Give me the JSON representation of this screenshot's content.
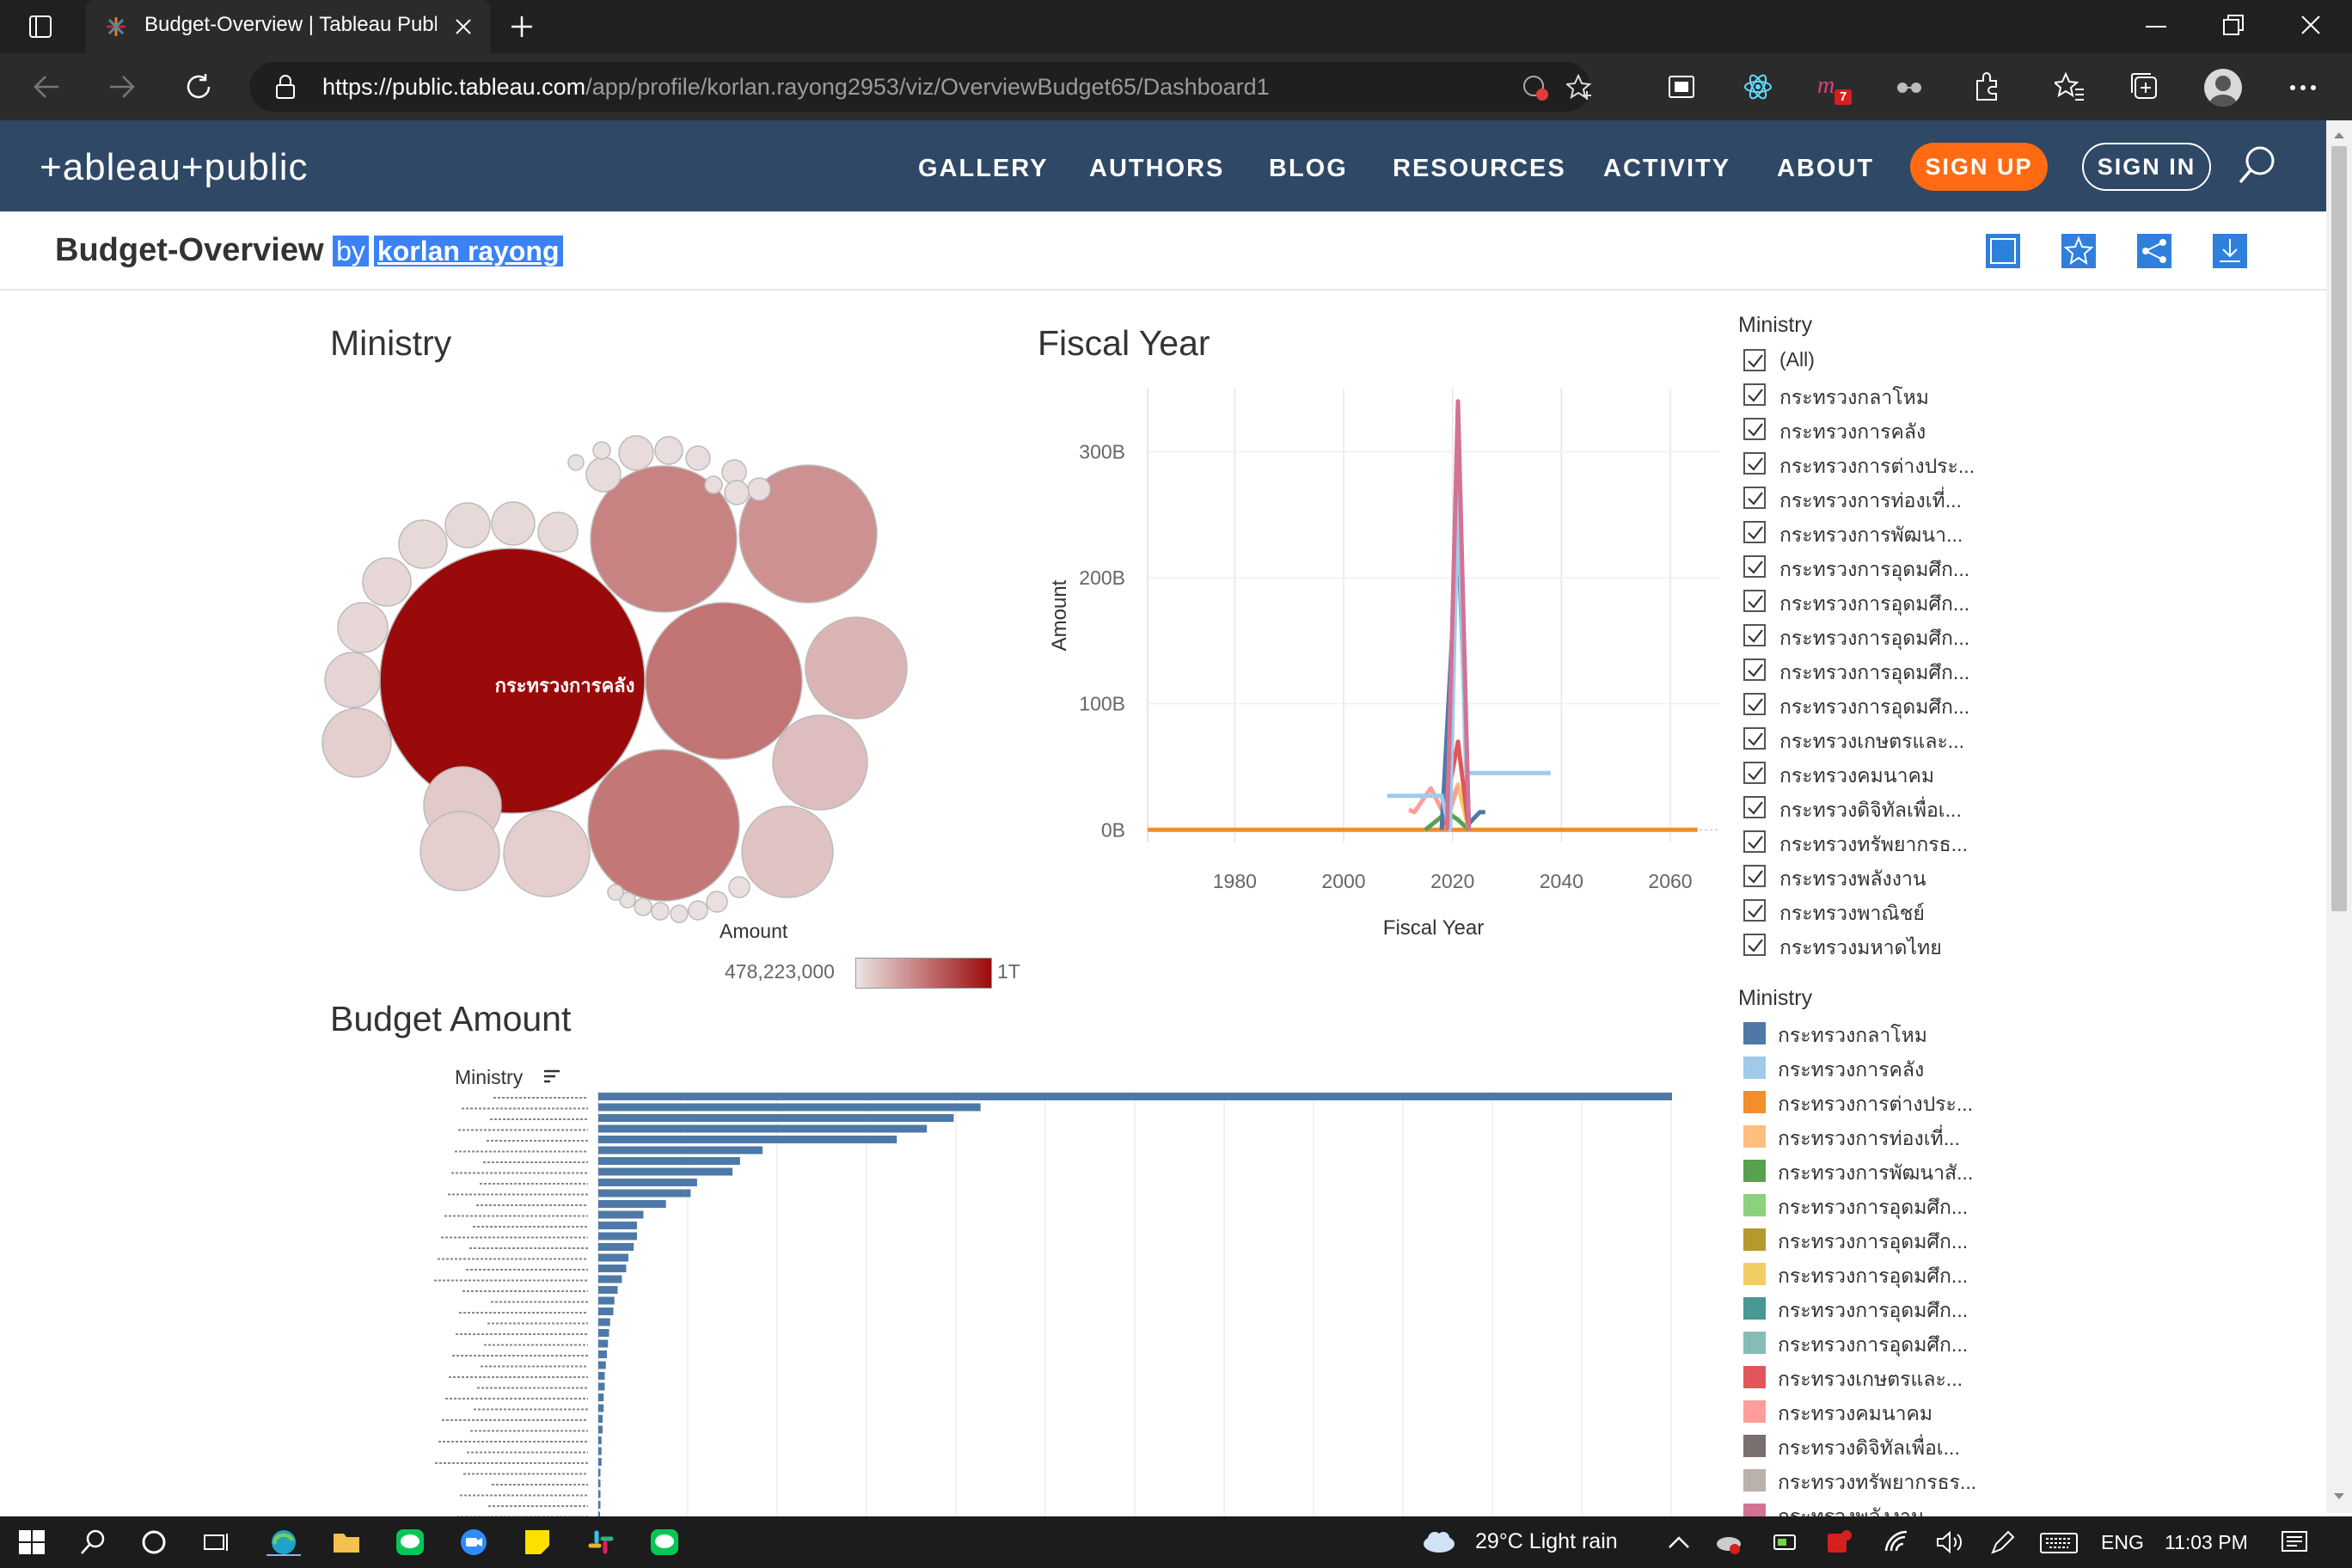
{
  "browser": {
    "tab_title": "Budget-Overview | Tableau Public",
    "url_host": "https://public.tableau.com",
    "url_path": "/app/profile/korlan.rayong2953/viz/OverviewBudget65/Dashboard1",
    "extension_badge": "7"
  },
  "site": {
    "logo": "+ableau+public",
    "nav": [
      "GALLERY",
      "AUTHORS",
      "BLOG",
      "RESOURCES",
      "ACTIVITY",
      "ABOUT"
    ],
    "sign_up": "SIGN UP",
    "sign_in": "SIGN IN"
  },
  "viz": {
    "title": "Budget-Overview",
    "by": "by",
    "author": "korlan rayong"
  },
  "bubble_sheet": {
    "title": "Ministry",
    "largest_label": "กระทรวงการคลัง",
    "legend_title": "Amount",
    "legend_min": "478,223,000",
    "legend_max": "1T",
    "color_low": "#ece4e4",
    "color_high": "#9b0a0a"
  },
  "line_sheet": {
    "title": "Fiscal Year"
  },
  "bar_sheet": {
    "title": "Budget Amount",
    "header": "Ministry",
    "bar_color": "#4e79a7"
  },
  "filter": {
    "title": "Ministry",
    "items": [
      "(All)",
      "กระทรวงกลาโหม",
      "กระทรวงการคลัง",
      "กระทรวงการต่างประ...",
      "กระทรวงการท่องเที่...",
      "กระทรวงการพัฒนา...",
      "กระทรวงการอุดมศึก...",
      "กระทรวงการอุดมศึก...",
      "กระทรวงการอุดมศึก...",
      "กระทรวงการอุดมศึก...",
      "กระทรวงการอุดมศึก...",
      "กระทรวงเกษตรและ...",
      "กระทรวงคมนาคม",
      "กระทรวงดิจิทัลเพื่อเ...",
      "กระทรวงทรัพยากรธ...",
      "กระทรวงพลังงาน",
      "กระทรวงพาณิชย์",
      "กระทรวงมหาดไทย"
    ]
  },
  "color_legend": {
    "title": "Ministry",
    "items": [
      {
        "label": "กระทรวงกลาโหม",
        "color": "#4e79a7"
      },
      {
        "label": "กระทรวงการคลัง",
        "color": "#a0cbe8"
      },
      {
        "label": "กระทรวงการต่างประ...",
        "color": "#f28e2b"
      },
      {
        "label": "กระทรวงการท่องเที่...",
        "color": "#ffbe7d"
      },
      {
        "label": "กระทรวงการพัฒนาสั...",
        "color": "#59a14f"
      },
      {
        "label": "กระทรวงการอุดมศึก...",
        "color": "#8cd17d"
      },
      {
        "label": "กระทรวงการอุดมศึก...",
        "color": "#b6992d"
      },
      {
        "label": "กระทรวงการอุดมศึก...",
        "color": "#f1ce63"
      },
      {
        "label": "กระทรวงการอุดมศึก...",
        "color": "#499894"
      },
      {
        "label": "กระทรวงการอุดมศึก...",
        "color": "#86bcb6"
      },
      {
        "label": "กระทรวงเกษตรและ...",
        "color": "#e15759"
      },
      {
        "label": "กระทรวงคมนาคม",
        "color": "#ff9d9a"
      },
      {
        "label": "กระทรวงดิจิทัลเพื่อเ...",
        "color": "#79706e"
      },
      {
        "label": "กระทรวงทรัพยากรธร...",
        "color": "#bab0ac"
      },
      {
        "label": "กระทรวงพลังงาน",
        "color": "#d37295"
      }
    ]
  },
  "taskbar": {
    "weather": "29°C  Light rain",
    "lang": "ENG",
    "time": "11:03 PM"
  },
  "chart_data": [
    {
      "type": "line",
      "title": "Fiscal Year",
      "xlabel": "Fiscal Year",
      "ylabel": "Amount",
      "x_ticks": [
        "1980",
        "2000",
        "2020",
        "2040",
        "2060"
      ],
      "y_ticks": [
        "0B",
        "100B",
        "200B",
        "300B"
      ],
      "xlim": [
        1964,
        2069
      ],
      "ylim": [
        -10,
        350
      ],
      "grid": true,
      "series": [
        {
          "name": "กระทรวงพลังงาน",
          "color": "#d37295",
          "points": [
            [
              2019,
              0
            ],
            [
              2021,
              340
            ],
            [
              2023,
              0
            ]
          ]
        },
        {
          "name": "กระทรวงการคลัง",
          "color": "#a0cbe8",
          "points": [
            [
              2008,
              27
            ],
            [
              2018,
              27
            ],
            [
              2019.5,
              0
            ],
            [
              2021,
              270
            ],
            [
              2022.5,
              45
            ],
            [
              2038,
              45
            ]
          ]
        },
        {
          "name": "กระทรวงกลาโหม",
          "color": "#4e79a7",
          "points": [
            [
              2018,
              0
            ],
            [
              2021,
              240
            ],
            [
              2023,
              5
            ],
            [
              2025,
              14
            ],
            [
              2026,
              14
            ]
          ]
        },
        {
          "name": "กระทรวงคมนาคม",
          "color": "#ff9d9a",
          "points": [
            [
              2012,
              16
            ],
            [
              2013,
              14
            ],
            [
              2016,
              33
            ],
            [
              2018,
              16
            ],
            [
              2019,
              8
            ],
            [
              2021,
              35
            ]
          ]
        },
        {
          "name": "กระทรวงเกษตรและ...",
          "color": "#e15759",
          "points": [
            [
              2018,
              0
            ],
            [
              2021,
              70
            ],
            [
              2023,
              0
            ]
          ]
        },
        {
          "name": "กระทรวงการอุดมศึก...",
          "color": "#f1ce63",
          "points": [
            [
              2018,
              0
            ],
            [
              2021,
              36
            ],
            [
              2023,
              0
            ]
          ]
        },
        {
          "name": "กระทรวงการพัฒนาสั...",
          "color": "#59a14f",
          "points": [
            [
              2015,
              0
            ],
            [
              2019,
              14
            ],
            [
              2021,
              8
            ],
            [
              2023,
              0
            ]
          ]
        },
        {
          "name": "กระทรวงการต่างประ...",
          "color": "#f28e2b",
          "points": [
            [
              1964,
              0
            ],
            [
              2065,
              0
            ]
          ]
        }
      ]
    },
    {
      "type": "bar",
      "title": "Budget Amount",
      "categories_visible": false,
      "values_relative": [
        100,
        35.6,
        33.1,
        30.6,
        27.8,
        15.3,
        13.2,
        12.5,
        9.2,
        8.6,
        6.3,
        4.2,
        3.6,
        3.6,
        3.3,
        2.8,
        2.6,
        2.2,
        1.8,
        1.5,
        1.4,
        1.1,
        1.0,
        0.9,
        0.8,
        0.7,
        0.6,
        0.6,
        0.5,
        0.5,
        0.4,
        0.4,
        0.3,
        0.3,
        0.3,
        0.2,
        0.2,
        0.2,
        0.2,
        0.1
      ]
    },
    {
      "type": "bubble",
      "title": "Ministry",
      "labeled_bubble": "กระทรวงการคลัง",
      "color_metric": "Amount"
    }
  ]
}
